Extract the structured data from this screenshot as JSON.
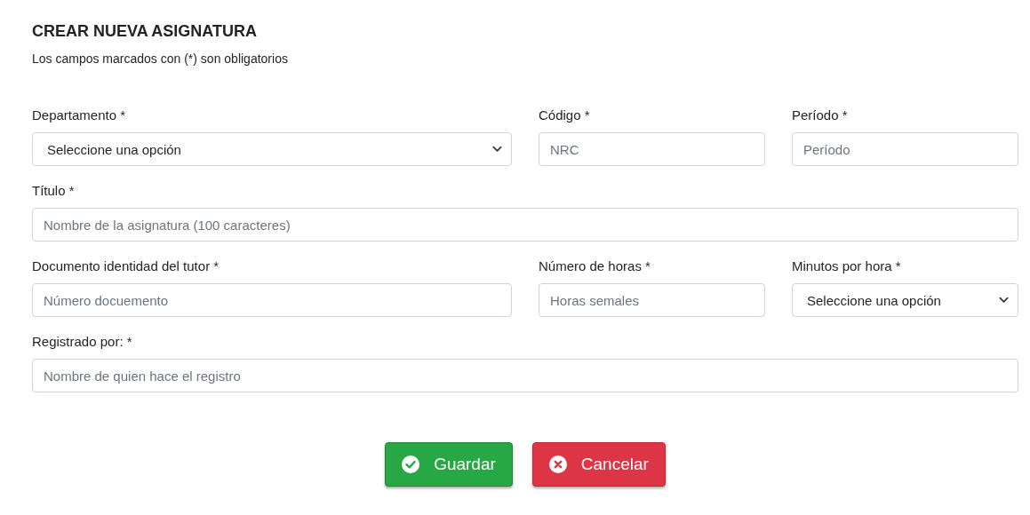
{
  "title": "CREAR NUEVA ASIGNATURA",
  "subtitle": "Los campos marcados con (*) son obligatorios",
  "rows": [
    [
      {
        "kind": "select",
        "label": "Departamento *",
        "value": "Seleccione una opción"
      },
      {
        "kind": "input",
        "label": "Código *",
        "placeholder": "NRC"
      },
      {
        "kind": "input",
        "label": "Período *",
        "placeholder": "Período"
      }
    ],
    [
      {
        "kind": "input",
        "label": "Título *",
        "placeholder": "Nombre de la asignatura (100 caracteres)"
      }
    ],
    [
      {
        "kind": "input",
        "label": "Documento identidad del tutor *",
        "placeholder": "Número docuemento"
      },
      {
        "kind": "input",
        "label": "Número de horas *",
        "placeholder": "Horas semales"
      },
      {
        "kind": "select",
        "label": "Minutos por hora *",
        "value": "Seleccione una opción"
      }
    ],
    [
      {
        "kind": "input",
        "label": "Registrado por: *",
        "placeholder": "Nombre de quien hace el registro"
      }
    ]
  ],
  "buttons": [
    {
      "kind": "save",
      "label": "Guardar"
    },
    {
      "kind": "cancel",
      "label": "Cancelar"
    }
  ]
}
